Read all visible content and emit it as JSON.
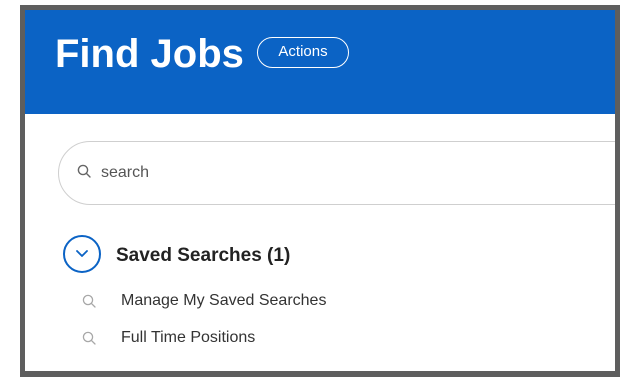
{
  "header": {
    "title": "Find Jobs",
    "actions_label": "Actions",
    "bg_color": "#0b63c5"
  },
  "search": {
    "placeholder": "search",
    "value": "",
    "icon": "search-icon"
  },
  "saved_searches": {
    "title": "Saved Searches (1)",
    "toggle_icon": "chevron-down-icon",
    "expanded": true,
    "items": [
      {
        "label": "Manage My Saved Searches",
        "icon": "search-icon"
      },
      {
        "label": "Full Time Positions",
        "icon": "search-icon"
      }
    ]
  }
}
